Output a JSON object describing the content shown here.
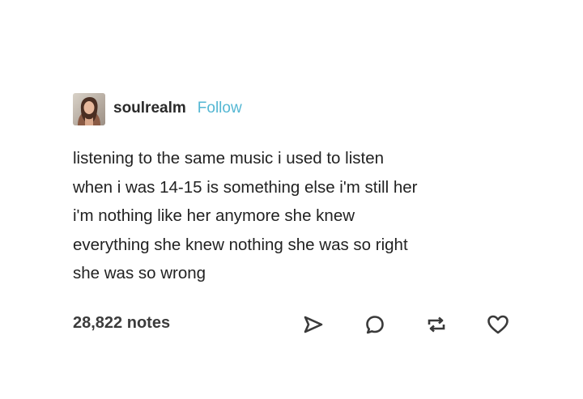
{
  "post": {
    "username": "soulrealm",
    "follow_label": "Follow",
    "avatar_icon": "user-avatar",
    "body_lines": [
      "listening to the same music i used to listen",
      "when i was 14-15 is something else i'm still her",
      "i'm nothing like her anymore she knew",
      "everything she knew nothing she was so right",
      "she was so wrong"
    ],
    "notes": "28,822 notes",
    "actions": [
      {
        "name": "share",
        "icon": "share-icon"
      },
      {
        "name": "reply",
        "icon": "reply-icon"
      },
      {
        "name": "reblog",
        "icon": "reblog-icon"
      },
      {
        "name": "like",
        "icon": "heart-icon"
      }
    ]
  },
  "colors": {
    "text": "#222222",
    "follow": "#54b7d3",
    "icon": "#3a3a3a",
    "background": "#ffffff"
  }
}
